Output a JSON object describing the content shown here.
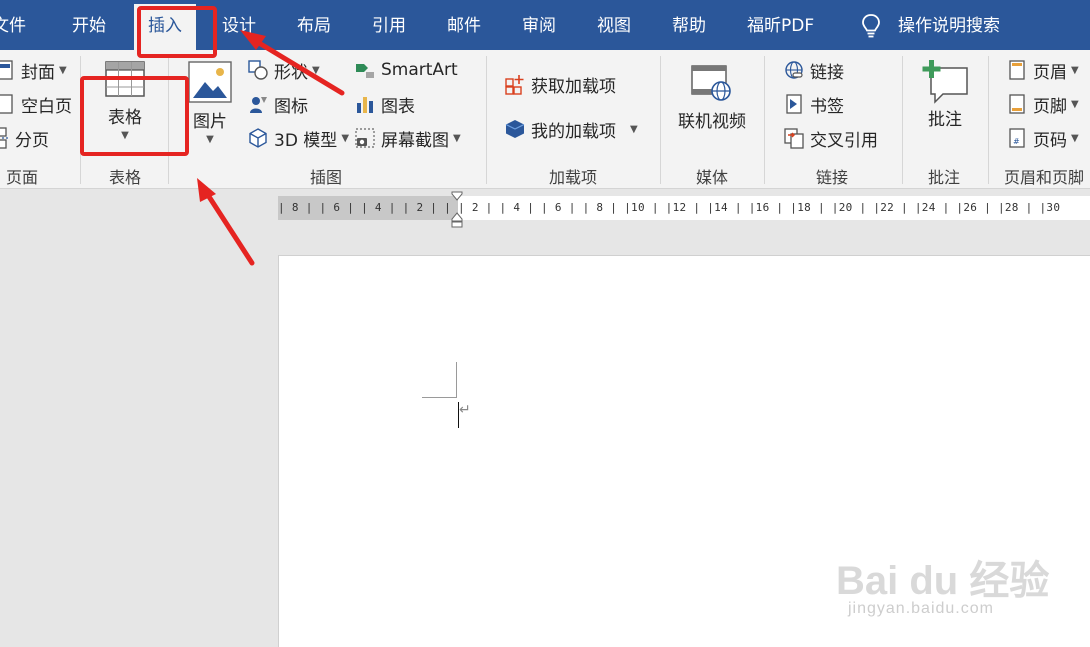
{
  "tabs": [
    {
      "label": "文件"
    },
    {
      "label": "开始"
    },
    {
      "label": "插入"
    },
    {
      "label": "设计"
    },
    {
      "label": "布局"
    },
    {
      "label": "引用"
    },
    {
      "label": "邮件"
    },
    {
      "label": "审阅"
    },
    {
      "label": "视图"
    },
    {
      "label": "帮助"
    },
    {
      "label": "福昕PDF"
    }
  ],
  "tell_me": {
    "label": "操作说明搜索",
    "icon": "lightbulb-icon"
  },
  "groups": {
    "pages": {
      "label": "页面",
      "items": [
        {
          "label": "封面",
          "icon": "cover-page-icon"
        },
        {
          "label": "空白页",
          "icon": "blank-page-icon"
        },
        {
          "label": "分页",
          "icon": "page-break-icon"
        }
      ]
    },
    "tables": {
      "label": "表格",
      "button": "表格",
      "icon": "table-icon"
    },
    "illustrations": {
      "label": "插图",
      "picture": "图片",
      "items": [
        {
          "label": "形状",
          "icon": "shapes-icon"
        },
        {
          "label": "图标",
          "icon": "icons-icon"
        },
        {
          "label": "3D 模型",
          "icon": "3d-model-icon"
        },
        {
          "label": "SmartArt",
          "icon": "smartart-icon"
        },
        {
          "label": "图表",
          "icon": "chart-icon"
        },
        {
          "label": "屏幕截图",
          "icon": "screenshot-icon"
        }
      ]
    },
    "addins": {
      "label": "加载项",
      "items": [
        {
          "label": "获取加载项",
          "icon": "get-addins-icon"
        },
        {
          "label": "我的加载项",
          "icon": "my-addins-icon"
        }
      ]
    },
    "media": {
      "label": "媒体",
      "button": "联机视频",
      "icon": "online-video-icon"
    },
    "links": {
      "label": "链接",
      "items": [
        {
          "label": "链接",
          "icon": "link-icon"
        },
        {
          "label": "书签",
          "icon": "bookmark-icon"
        },
        {
          "label": "交叉引用",
          "icon": "cross-reference-icon"
        }
      ]
    },
    "comments": {
      "label": "批注",
      "button": "批注",
      "icon": "comment-icon"
    },
    "header_footer": {
      "label": "页眉和页脚",
      "items": [
        {
          "label": "页眉",
          "icon": "header-icon"
        },
        {
          "label": "页脚",
          "icon": "footer-icon"
        },
        {
          "label": "页码",
          "icon": "page-number-icon"
        }
      ]
    }
  },
  "ruler": {
    "numbers": "| 8 |  | 6 |  | 4 |  | 2 |  |    | 2 |  | 4 |  | 6 |  | 8 |  |10 |  |12 |  |14 |  |16 |  |18 |  |20 |  |22 |  |24 |  |26 |  |28 |  |30"
  },
  "colors": {
    "ribbon_tab_bar": "#2b579a",
    "highlight": "#e52421",
    "ribbon_bg": "#f3f3f3"
  },
  "watermark": {
    "brand": "Bai du 经验",
    "url": "jingyan.baidu.com"
  }
}
